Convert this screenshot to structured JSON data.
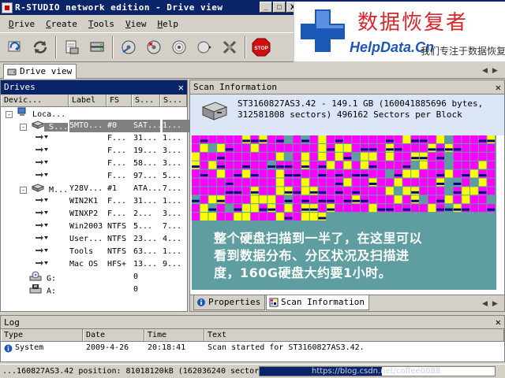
{
  "window": {
    "title": "R-STUDIO network edition - Drive view",
    "min": "_",
    "max": "□",
    "close": "X"
  },
  "watermark": {
    "cn_title": "数据恢复者",
    "site": "HelpData.Cn",
    "slogan": "我们专注于数据恢复",
    "footer": "https://blog.csdn.net/coffee0088"
  },
  "menu": [
    "Drive",
    "Create",
    "Tools",
    "View",
    "Help"
  ],
  "toolbar": {
    "buttons": [
      "refresh-icon",
      "reload-icon",
      "open-drive-icon",
      "drive-stack-icon",
      "recover-icon",
      "recover-marked-icon",
      "scan-icon",
      "create-image-icon",
      "disconnect-icon",
      "stop-icon"
    ],
    "stop_label": "STOP"
  },
  "view_tab": {
    "label": "Drive view"
  },
  "drives": {
    "title": "Drives",
    "columns": [
      "Devic...",
      "Label",
      "FS",
      "S...",
      "S..."
    ],
    "rows": [
      {
        "name": "Loca...",
        "label": "",
        "fs": "",
        "s1": "",
        "s2": "",
        "level": 0,
        "expander": "-",
        "icon": "computer-icon"
      },
      {
        "name": "S...",
        "label": "5MTO...",
        "fs": "#0",
        "s1": "SAT...",
        "s2": "1...",
        "level": 1,
        "expander": "-",
        "icon": "disk-icon",
        "selected": true
      },
      {
        "name": "",
        "label": "",
        "fs": "F...",
        "s1": "31...",
        "s2": "1...",
        "level": 2,
        "expander": "",
        "icon": "partition-icon"
      },
      {
        "name": "",
        "label": "",
        "fs": "F...",
        "s1": "19...",
        "s2": "3...",
        "level": 2,
        "expander": "",
        "icon": "partition-icon"
      },
      {
        "name": "",
        "label": "",
        "fs": "F...",
        "s1": "58...",
        "s2": "3...",
        "level": 2,
        "expander": "",
        "icon": "partition-icon"
      },
      {
        "name": "",
        "label": "",
        "fs": "F...",
        "s1": "97...",
        "s2": "5...",
        "level": 2,
        "expander": "",
        "icon": "partition-icon"
      },
      {
        "name": "M...",
        "label": "Y28V...",
        "fs": "#1",
        "s1": "ATA...",
        "s2": "7...",
        "level": 1,
        "expander": "-",
        "icon": "disk-icon"
      },
      {
        "name": "",
        "label": "WIN2K1",
        "fs": "F...",
        "s1": "31...",
        "s2": "1...",
        "level": 2,
        "expander": "",
        "icon": "partition-icon"
      },
      {
        "name": "",
        "label": "WINXP2",
        "fs": "F...",
        "s1": "2...",
        "s2": "3...",
        "level": 2,
        "expander": "",
        "icon": "partition-icon"
      },
      {
        "name": "",
        "label": "Win2003",
        "fs": "NTFS",
        "s1": "5...",
        "s2": "7...",
        "level": 2,
        "expander": "",
        "icon": "partition-icon"
      },
      {
        "name": "",
        "label": "User...",
        "fs": "NTFS",
        "s1": "23...",
        "s2": "4...",
        "level": 2,
        "expander": "",
        "icon": "partition-icon"
      },
      {
        "name": "",
        "label": "Tools",
        "fs": "NTFS",
        "s1": "63...",
        "s2": "1...",
        "level": 2,
        "expander": "",
        "icon": "partition-icon"
      },
      {
        "name": "",
        "label": "Mac OS",
        "fs": "HFS+",
        "s1": "13...",
        "s2": "9...",
        "level": 2,
        "expander": "",
        "icon": "partition-icon"
      },
      {
        "name": "G:",
        "label": "",
        "fs": "",
        "s1": "0",
        "s2": "",
        "level": 1,
        "expander": "",
        "icon": "cdrom-icon"
      },
      {
        "name": "A:",
        "label": "",
        "fs": "",
        "s1": "0",
        "s2": "",
        "level": 1,
        "expander": "",
        "icon": "floppy-icon"
      }
    ]
  },
  "scan": {
    "title": "Scan Information",
    "line1": "ST3160827AS3.42 - 149.1 GB (160041885696 bytes,",
    "line2": "312581808 sectors)  496162 Sectors per Block",
    "overlay_line1": "整个硬盘扫描到一半了，在这里可以",
    "overlay_line2": "看到数据分布、分区状况及扫描进",
    "overlay_line3": "度，160G硬盘大约要1小时。",
    "tabs": [
      "Properties",
      "Scan Information"
    ],
    "colors": {
      "empty": "#5e9ea0",
      "fat": "#ff00ff",
      "ntfs": "#ffff00",
      "other": "#000080"
    }
  },
  "log": {
    "title": "Log",
    "columns": [
      "Type",
      "Date",
      "Time",
      "Text"
    ],
    "rows": [
      {
        "type": "System",
        "date": "2009-4-26",
        "time": "20:18:41",
        "text": "Scan started for ST3160827AS3.42."
      }
    ]
  },
  "status": {
    "text": "...160827AS3.42 position: 81018120kB (162036240 sector",
    "progress": 0.52
  }
}
